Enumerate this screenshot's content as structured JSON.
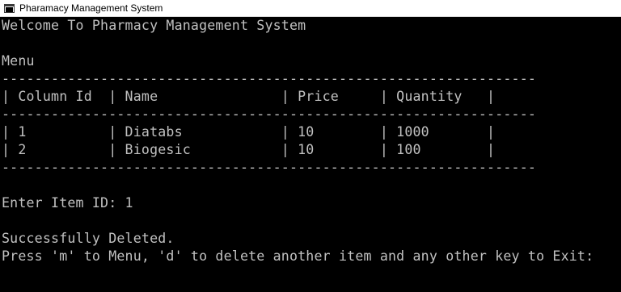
{
  "window": {
    "title": "Pharamacy Management System",
    "icon": "console-app-icon"
  },
  "console": {
    "lines": [
      "Welcome To Pharmacy Management System",
      "",
      "Menu",
      "-----------------------------------------------------------------",
      "| Column Id  | Name               | Price     | Quantity   |",
      "-----------------------------------------------------------------",
      "| 1          | Diatabs            | 10        | 1000       |",
      "| 2          | Biogesic           | 10        | 100        |",
      "-----------------------------------------------------------------",
      "",
      "Enter Item ID: 1",
      "",
      "Successfully Deleted.",
      "Press 'm' to Menu, 'd' to delete another item and any other key to Exit:"
    ]
  },
  "colors": {
    "console_background": "#000000",
    "console_text": "#c0c0c0",
    "titlebar_background": "#ffffff"
  }
}
